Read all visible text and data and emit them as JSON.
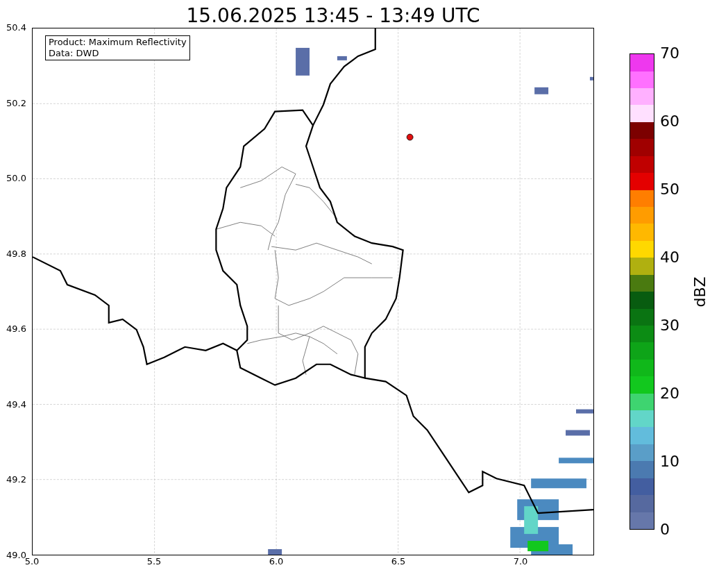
{
  "title": "15.06.2025 13:45 - 13:49 UTC",
  "info_box": [
    "Product: Maximum Reflectivity",
    "Data: DWD"
  ],
  "axes": {
    "x_ticks": [
      "5.0",
      "5.5",
      "6.0",
      "6.5",
      "7.0"
    ],
    "y_ticks": [
      "50.4",
      "50.2",
      "50.0",
      "49.8",
      "49.6",
      "49.4",
      "49.2",
      "49.0"
    ]
  },
  "colorbar": {
    "label": "dBZ",
    "ticks": [
      "70",
      "60",
      "50",
      "40",
      "30",
      "20",
      "10",
      "0"
    ],
    "segments": [
      {
        "color": "#6677aa"
      },
      {
        "color": "#56699f"
      },
      {
        "color": "#435ea0"
      },
      {
        "color": "#4b7ab0"
      },
      {
        "color": "#5a9ec8"
      },
      {
        "color": "#62bcdc"
      },
      {
        "color": "#62d6c8"
      },
      {
        "color": "#3ed470"
      },
      {
        "color": "#12c81e"
      },
      {
        "color": "#10b81a"
      },
      {
        "color": "#0ea418"
      },
      {
        "color": "#0c8c14"
      },
      {
        "color": "#0a7412"
      },
      {
        "color": "#085c10"
      },
      {
        "color": "#4a7a10"
      },
      {
        "color": "#b0b010"
      },
      {
        "color": "#ffd800"
      },
      {
        "color": "#ffb800"
      },
      {
        "color": "#ff9c00"
      },
      {
        "color": "#ff7e00"
      },
      {
        "color": "#e40000"
      },
      {
        "color": "#c00000"
      },
      {
        "color": "#a00000"
      },
      {
        "color": "#7c0000"
      },
      {
        "color": "#ffe0ff"
      },
      {
        "color": "#ffb0ff"
      },
      {
        "color": "#ff70ff"
      },
      {
        "color": "#ee38ee"
      }
    ]
  }
}
